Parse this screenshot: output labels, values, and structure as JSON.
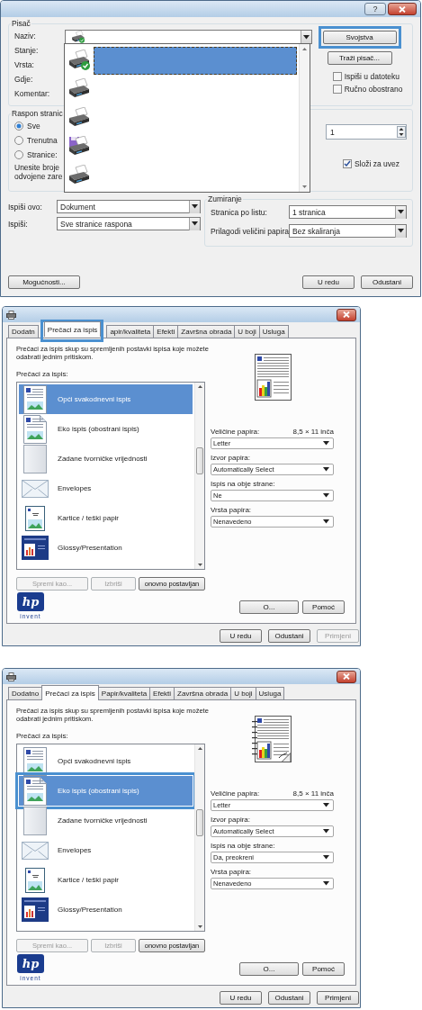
{
  "print_dialog": {
    "help_button": "?",
    "printer": {
      "group_title": "Pisač",
      "labels": [
        "Naziv:",
        "Stanje:",
        "Vrsta:",
        "Gdje:",
        "Komentar:"
      ],
      "buttons": [
        {
          "label": "Svojstva",
          "highlighted": true
        },
        {
          "label": "Traži pisač...",
          "highlighted": false
        }
      ],
      "checkboxes": [
        {
          "label": "Ispiši u datoteku",
          "checked": false
        },
        {
          "label": "Ručno obostrano",
          "checked": false
        }
      ]
    },
    "printer_list": [
      {
        "kind": "default",
        "selected": true
      },
      {
        "kind": "printer",
        "selected": false
      },
      {
        "kind": "printer",
        "selected": false
      },
      {
        "kind": "file",
        "selected": false
      },
      {
        "kind": "printer",
        "selected": false
      }
    ],
    "page_range": {
      "group_title": "Raspon stranic",
      "options": [
        {
          "label": "Sve",
          "selected": true
        },
        {
          "label": "Trenutna",
          "selected": false
        },
        {
          "label": "Stranice:",
          "selected": false
        }
      ],
      "hint": [
        "Unesite broje",
        "odvojene zare"
      ]
    },
    "copies": {
      "value": "1",
      "collate": {
        "label": "Složi za uvez",
        "checked": true
      }
    },
    "print_what": [
      {
        "label": "Ispiši ovo:",
        "value": "Dokument"
      },
      {
        "label": "Ispiši:",
        "value": "Sve stranice raspona"
      }
    ],
    "zoom": {
      "group_title": "Zumiranje",
      "rows": [
        {
          "label": "Stranica po listu:",
          "value": "1 stranica"
        },
        {
          "label": "Prilagodi veličini papira",
          "value": "Bez skaliranja"
        }
      ]
    },
    "options_button": "Mogućnosti...",
    "footer_buttons": [
      "U redu",
      "Odustani"
    ]
  },
  "properties_dialogs": [
    {
      "tabs": [
        {
          "label": "Dodatn",
          "selected": false,
          "highlighted": false
        },
        {
          "label": "Prečaci za ispis",
          "selected": true,
          "highlighted": true
        },
        {
          "label": "apir/kvaliteta",
          "selected": false,
          "highlighted": false
        },
        {
          "label": "Efekti",
          "selected": false,
          "highlighted": false
        },
        {
          "label": "Završna obrada",
          "selected": false,
          "highlighted": false
        },
        {
          "label": "U boji",
          "selected": false,
          "highlighted": false
        },
        {
          "label": "Usluga",
          "selected": false,
          "highlighted": false
        }
      ],
      "description": "Prečaci za ispis skup su spremljenih postavki ispisa koje možete odabrati jednim pritiskom.",
      "list_label": "Prečaci za ispis:",
      "shortcuts": [
        {
          "label": "Opći svakodnevni ispis",
          "kind": "document",
          "selected": true,
          "highlighted": false
        },
        {
          "label": "Eko ispis (obostrani ispis)",
          "kind": "duplex",
          "selected": false,
          "highlighted": false
        },
        {
          "label": "Zadane tvorničke vrijednosti",
          "kind": "blank",
          "selected": false,
          "highlighted": false
        },
        {
          "label": "Envelopes",
          "kind": "envelope",
          "selected": false,
          "highlighted": false
        },
        {
          "label": "Kartice / teški papir",
          "kind": "card",
          "selected": false,
          "highlighted": false
        },
        {
          "label": "Glossy/Presentation",
          "kind": "slide",
          "selected": false,
          "highlighted": false
        }
      ],
      "preview": {
        "duplex": false
      },
      "fields": [
        {
          "label": "Veličine papira:",
          "note": "8,5 × 11 inča",
          "value": "Letter"
        },
        {
          "label": "Izvor papira:",
          "value": "Automatically Select"
        },
        {
          "label": "Ispis na obje strane:",
          "value": "Ne"
        },
        {
          "label": "Vrsta papira:",
          "value": "Nenavedeno"
        }
      ],
      "list_buttons": [
        {
          "label": "Spremi kao...",
          "disabled": true
        },
        {
          "label": "Izbriši",
          "disabled": true
        },
        {
          "label": "onovno postavljan",
          "disabled": false
        }
      ],
      "logo": {
        "mark": "hp",
        "tagline": "invent"
      },
      "side_buttons": [
        "O...",
        "Pomoć"
      ],
      "footer_buttons": [
        {
          "label": "U redu",
          "disabled": false
        },
        {
          "label": "Odustani",
          "disabled": false
        },
        {
          "label": "Primjeni",
          "disabled": true
        }
      ]
    },
    {
      "tabs": [
        {
          "label": "Dodatno",
          "selected": false,
          "highlighted": false
        },
        {
          "label": "Prečaci za ispis",
          "selected": true,
          "highlighted": false
        },
        {
          "label": "Papir/kvaliteta",
          "selected": false,
          "highlighted": false
        },
        {
          "label": "Efekti",
          "selected": false,
          "highlighted": false
        },
        {
          "label": "Završna obrada",
          "selected": false,
          "highlighted": false
        },
        {
          "label": "U boji",
          "selected": false,
          "highlighted": false
        },
        {
          "label": "Usluga",
          "selected": false,
          "highlighted": false
        }
      ],
      "description": "Prečaci za ispis skup su spremljenih postavki ispisa koje možete odabrati jednim pritiskom.",
      "list_label": "Prečaci za ispis:",
      "shortcuts": [
        {
          "label": "Opći svakodnevni ispis",
          "kind": "document",
          "selected": false,
          "highlighted": false
        },
        {
          "label": "Eko ispis (obostrani ispis)",
          "kind": "duplex",
          "selected": true,
          "highlighted": true
        },
        {
          "label": "Zadane tvorničke vrijednosti",
          "kind": "blank",
          "selected": false,
          "highlighted": false
        },
        {
          "label": "Envelopes",
          "kind": "envelope",
          "selected": false,
          "highlighted": false
        },
        {
          "label": "Kartice / teški papir",
          "kind": "card",
          "selected": false,
          "highlighted": false
        },
        {
          "label": "Glossy/Presentation",
          "kind": "slide",
          "selected": false,
          "highlighted": false
        }
      ],
      "preview": {
        "duplex": true
      },
      "fields": [
        {
          "label": "Veličine papira:",
          "note": "8,5 × 11 inča",
          "value": "Letter"
        },
        {
          "label": "Izvor papira:",
          "value": "Automatically Select"
        },
        {
          "label": "Ispis na obje strane:",
          "value": "Da, preokreni"
        },
        {
          "label": "Vrsta papira:",
          "value": "Nenavedeno"
        }
      ],
      "list_buttons": [
        {
          "label": "Spremi kao...",
          "disabled": true
        },
        {
          "label": "Izbriši",
          "disabled": true
        },
        {
          "label": "onovno postavljan",
          "disabled": false
        }
      ],
      "logo": {
        "mark": "hp",
        "tagline": "invent"
      },
      "side_buttons": [
        "O...",
        "Pomoć"
      ],
      "footer_buttons": [
        {
          "label": "U redu",
          "disabled": false
        },
        {
          "label": "Odustani",
          "disabled": false
        },
        {
          "label": "Primjeni",
          "disabled": false
        }
      ]
    }
  ]
}
